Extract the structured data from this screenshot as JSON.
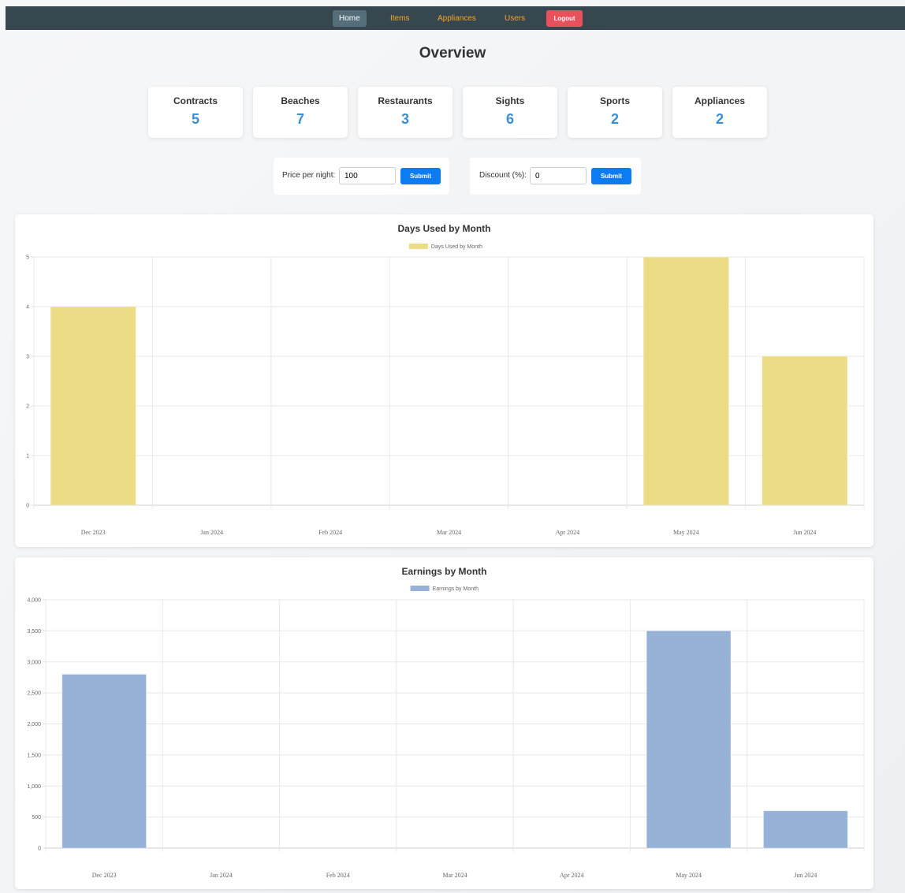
{
  "nav": {
    "home": "Home",
    "items": "Items",
    "appliances": "Appliances",
    "users": "Users",
    "logout": "Logout"
  },
  "page_title": "Overview",
  "stats": [
    {
      "label": "Contracts",
      "value": "5"
    },
    {
      "label": "Beaches",
      "value": "7"
    },
    {
      "label": "Restaurants",
      "value": "3"
    },
    {
      "label": "Sights",
      "value": "6"
    },
    {
      "label": "Sports",
      "value": "2"
    },
    {
      "label": "Appliances",
      "value": "2"
    }
  ],
  "forms": {
    "price": {
      "label": "Price per night:",
      "value": "100",
      "submit": "Submit"
    },
    "discount": {
      "label": "Discount (%):",
      "value": "0",
      "submit": "Submit"
    }
  },
  "chart_data": [
    {
      "type": "bar",
      "title": "Days Used by Month",
      "legend": "Days Used by Month",
      "legend_position": "top-center",
      "categories": [
        "Dec 2023",
        "Jan 2024",
        "Feb 2024",
        "Mar 2024",
        "Apr 2024",
        "May 2024",
        "Jun 2024"
      ],
      "values": [
        4,
        0,
        0,
        0,
        0,
        5,
        3
      ],
      "ylim": [
        0,
        5
      ],
      "yticks": [
        "0",
        "1",
        "2",
        "3",
        "4",
        "5"
      ],
      "grid": true,
      "color": "#ecdc85"
    },
    {
      "type": "bar",
      "title": "Earnings by Month",
      "legend": "Earnings by Month",
      "legend_position": "top-center",
      "categories": [
        "Dec 2023",
        "Jan 2024",
        "Feb 2024",
        "Mar 2024",
        "Apr 2024",
        "May 2024",
        "Jun 2024"
      ],
      "values": [
        2800,
        0,
        0,
        0,
        0,
        3500,
        600
      ],
      "ylim": [
        0,
        4000
      ],
      "yticks": [
        "0",
        "500",
        "1,000",
        "1,500",
        "2,000",
        "2,500",
        "3,000",
        "3,500",
        "4,000"
      ],
      "grid": true,
      "color": "#96b2d6"
    }
  ]
}
